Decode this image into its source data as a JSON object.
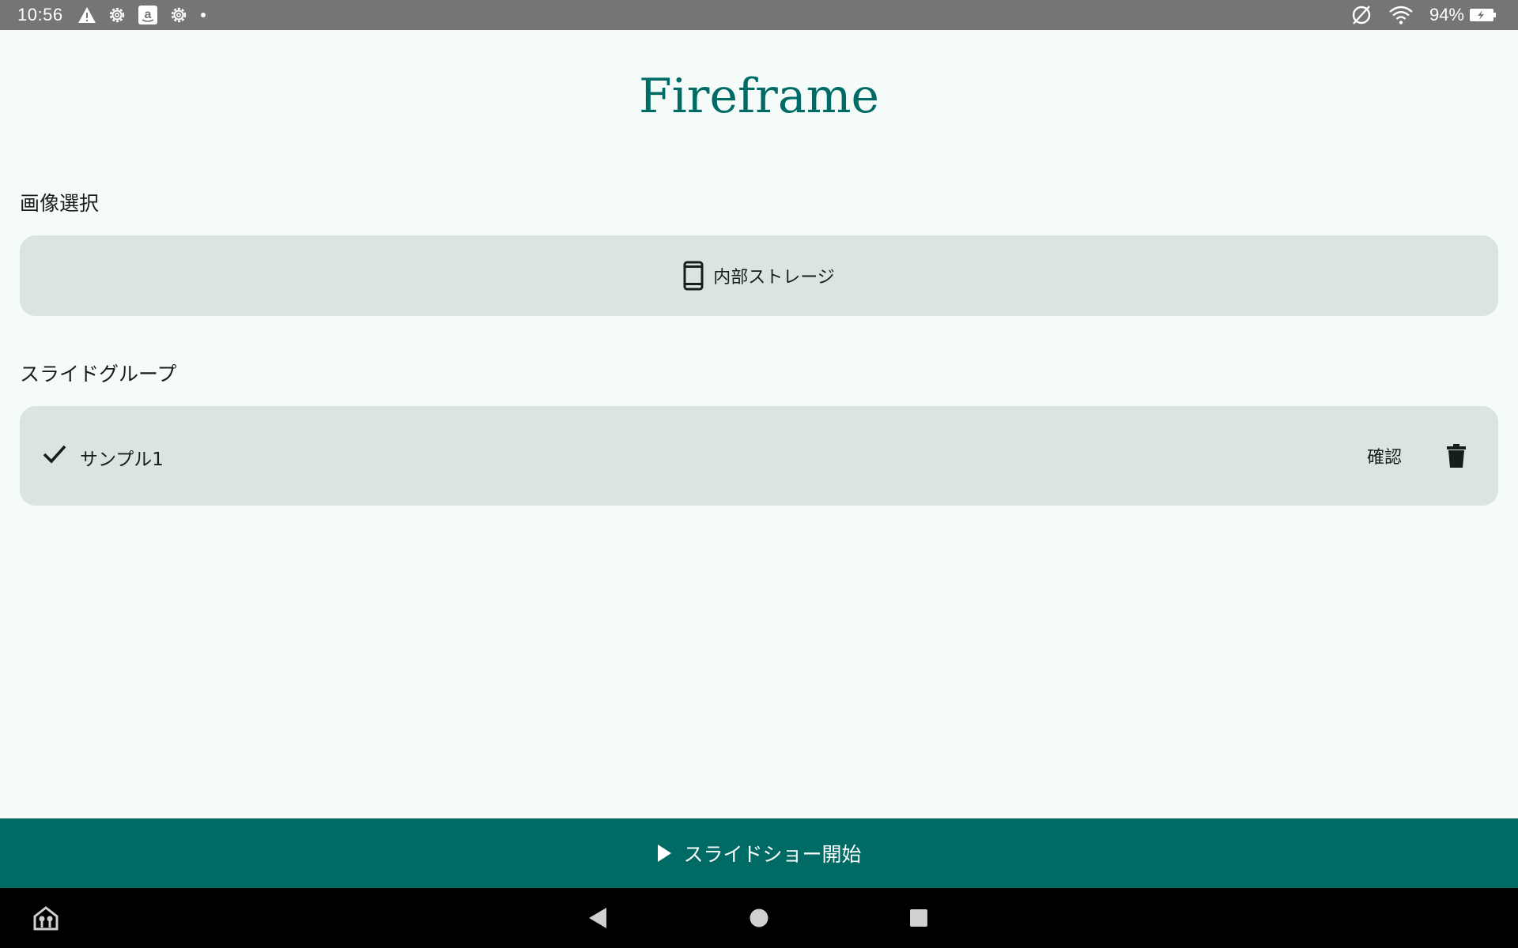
{
  "status_bar": {
    "time": "10:56",
    "battery_percent": "94%",
    "icons_left": [
      "warning-icon",
      "settings-icon",
      "amazon-icon",
      "settings-icon",
      "dot-icon"
    ],
    "icons_right": [
      "no-sim-icon",
      "wifi-icon",
      "battery-charging-icon"
    ]
  },
  "app": {
    "title": "Fireframe",
    "accent_color": "#006A65",
    "surface_color": "#DAE5E3",
    "background_color": "#F4FBF8"
  },
  "image_selection": {
    "label": "画像選択",
    "storage_button": {
      "icon": "smartphone-icon",
      "label": "内部ストレージ"
    }
  },
  "slide_groups": {
    "label": "スライドグループ",
    "items": [
      {
        "name": "サンプル1",
        "selected": true,
        "confirm_label": "確認",
        "delete_icon": "trash-icon"
      }
    ]
  },
  "slideshow_bar": {
    "icon": "play-icon",
    "label": "スライドショー開始"
  },
  "nav_bar": {
    "buttons": [
      "home-app-icon",
      "back-icon",
      "home-icon",
      "recents-icon"
    ]
  }
}
